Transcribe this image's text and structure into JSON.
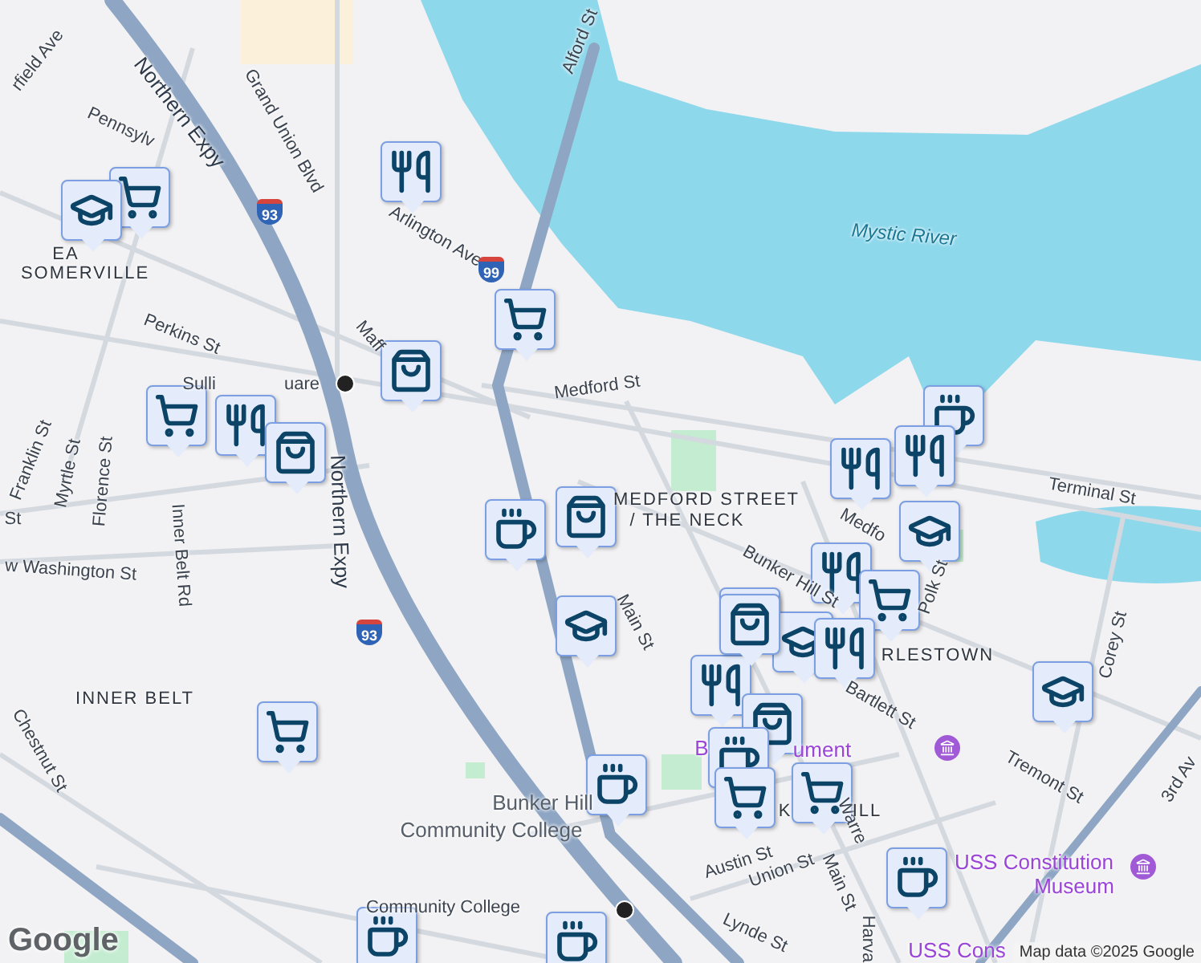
{
  "map": {
    "labels": [
      {
        "text": "rfield Ave",
        "kind": "street"
      },
      {
        "text": "Northern Expy",
        "kind": "highway"
      },
      {
        "text": "Grand Union Blvd",
        "kind": "street"
      },
      {
        "text": "Pennsylv",
        "kind": "street"
      },
      {
        "text": "EA",
        "kind": "area"
      },
      {
        "text": "SOMERVILLE",
        "kind": "area"
      },
      {
        "text": "Perkins St",
        "kind": "street"
      },
      {
        "text": "Arlington Ave",
        "kind": "street"
      },
      {
        "text": "Maff",
        "kind": "street"
      },
      {
        "text": "Alford St",
        "kind": "street"
      },
      {
        "text": "Mystic River",
        "kind": "water"
      },
      {
        "text": "Medford St",
        "kind": "street"
      },
      {
        "text": "Franklin St",
        "kind": "street"
      },
      {
        "text": "Myrtle St",
        "kind": "street"
      },
      {
        "text": "Florence St",
        "kind": "street"
      },
      {
        "text": "Sulli",
        "kind": "street"
      },
      {
        "text": "uare",
        "kind": "street"
      },
      {
        "text": "Northern Expy",
        "kind": "highway"
      },
      {
        "text": "St",
        "kind": "street"
      },
      {
        "text": "w Washington St",
        "kind": "street"
      },
      {
        "text": "Inner Belt Rd",
        "kind": "street"
      },
      {
        "text": "INNER BELT",
        "kind": "area"
      },
      {
        "text": "Chestnut St",
        "kind": "street"
      },
      {
        "text": "Bunker Hill",
        "kind": "place"
      },
      {
        "text": "Community College",
        "kind": "place"
      },
      {
        "text": "Community College",
        "kind": "street"
      },
      {
        "text": "Main St",
        "kind": "street"
      },
      {
        "text": "MEDFORD STREET",
        "kind": "area"
      },
      {
        "text": "/ THE NECK",
        "kind": "area"
      },
      {
        "text": "Medfo",
        "kind": "street"
      },
      {
        "text": "Bunker Hill St",
        "kind": "street"
      },
      {
        "text": "Terminal St",
        "kind": "street"
      },
      {
        "text": "Polk St",
        "kind": "street"
      },
      {
        "text": "RLESTOWN",
        "kind": "area"
      },
      {
        "text": "Bartlett St",
        "kind": "street"
      },
      {
        "text": "Corey St",
        "kind": "street"
      },
      {
        "text": "Tremont St",
        "kind": "street"
      },
      {
        "text": "3rd Av",
        "kind": "street"
      },
      {
        "text": "B",
        "kind": "poi"
      },
      {
        "text": "ument",
        "kind": "poi"
      },
      {
        "text": "Austin St",
        "kind": "street"
      },
      {
        "text": "Union St",
        "kind": "street"
      },
      {
        "text": "Main St",
        "kind": "street"
      },
      {
        "text": "Warre",
        "kind": "street"
      },
      {
        "text": "Lynde St",
        "kind": "street"
      },
      {
        "text": "Harva",
        "kind": "street"
      },
      {
        "text": "USS Constitution",
        "kind": "poi"
      },
      {
        "text": "Museum",
        "kind": "poi"
      },
      {
        "text": "USS Cons",
        "kind": "poi"
      },
      {
        "text": "K",
        "kind": "area"
      },
      {
        "text": "ILL",
        "kind": "area"
      }
    ],
    "shields": [
      {
        "text": "93"
      },
      {
        "text": "99"
      },
      {
        "text": "93"
      }
    ],
    "markers": [
      {
        "kind": "grocery"
      },
      {
        "kind": "school"
      },
      {
        "kind": "restaurant"
      },
      {
        "kind": "grocery"
      },
      {
        "kind": "shop"
      },
      {
        "kind": "grocery"
      },
      {
        "kind": "restaurant"
      },
      {
        "kind": "shop"
      },
      {
        "kind": "cafe"
      },
      {
        "kind": "restaurant"
      },
      {
        "kind": "restaurant"
      },
      {
        "kind": "school"
      },
      {
        "kind": "cafe"
      },
      {
        "kind": "shop"
      },
      {
        "kind": "restaurant"
      },
      {
        "kind": "grocery"
      },
      {
        "kind": "shop"
      },
      {
        "kind": "school"
      },
      {
        "kind": "school"
      },
      {
        "kind": "restaurant"
      },
      {
        "kind": "restaurant"
      },
      {
        "kind": "shop"
      },
      {
        "kind": "shop"
      },
      {
        "kind": "cafe"
      },
      {
        "kind": "grocery"
      },
      {
        "kind": "grocery"
      },
      {
        "kind": "grocery"
      },
      {
        "kind": "cafe"
      },
      {
        "kind": "school"
      },
      {
        "kind": "cafe"
      },
      {
        "kind": "cafe"
      },
      {
        "kind": "cafe"
      }
    ],
    "logo": "Google",
    "attribution": "Map data ©2025 Google"
  }
}
